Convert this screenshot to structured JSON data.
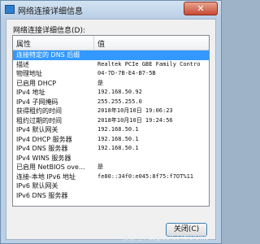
{
  "window": {
    "title": "网络连接详细信息",
    "close_label": "✕"
  },
  "section_label": "网络连接详细信息(D):",
  "table": {
    "columns": [
      "属性",
      "值"
    ],
    "rows": [
      {
        "property": "连接特定的 DNS 后缀",
        "value": ""
      },
      {
        "property": "描述",
        "value": "Realtek PCIe GBE Family Contro"
      },
      {
        "property": "物理地址",
        "value": "04-7D-7B-E4-B7-5B"
      },
      {
        "property": "已启用 DHCP",
        "value": "是"
      },
      {
        "property": "IPv4 地址",
        "value": "192.168.50.92"
      },
      {
        "property": "IPv4 子网掩码",
        "value": "255.255.255.0"
      },
      {
        "property": "获得租约的时间",
        "value": "2018年10月10日 19:06:23"
      },
      {
        "property": "租约过期的时间",
        "value": "2018年10月10日 19:24:56"
      },
      {
        "property": "IPv4 默认网关",
        "value": "192.168.50.1"
      },
      {
        "property": "IPv4 DHCP 服务器",
        "value": "192.168.50.1"
      },
      {
        "property": "IPv4 DNS 服务器",
        "value": "192.168.50.1"
      },
      {
        "property": "IPv4 WINS 服务器",
        "value": ""
      },
      {
        "property": "已启用 NetBIOS ove...",
        "value": "是"
      },
      {
        "property": "连接-本地 IPv6 地址",
        "value": "fe80::34f0:e045:8f75:f7OT%11"
      },
      {
        "property": "IPv6 默认网关",
        "value": ""
      },
      {
        "property": "IPv6 DNS 服务器",
        "value": ""
      }
    ]
  },
  "ok_button": "关闭(C)",
  "watermark": "头条号 / LogicalControlUnit"
}
